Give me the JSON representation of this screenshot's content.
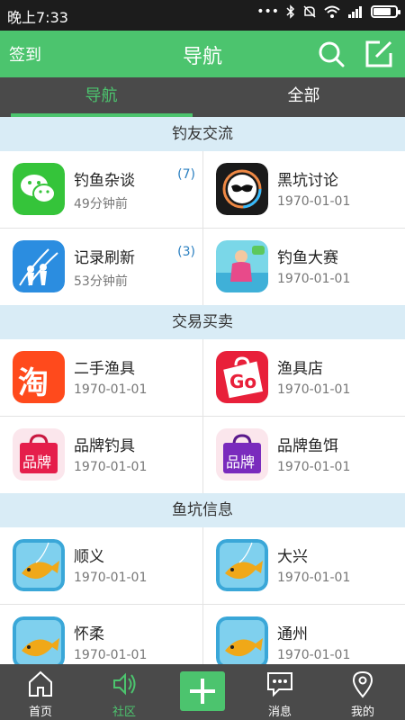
{
  "status_bar": {
    "time": "晚上7:33",
    "icons": [
      "dots-icon",
      "bluetooth-icon",
      "mute-icon",
      "wifi-icon",
      "signal-icon",
      "battery-icon"
    ],
    "battery_level": 0.85
  },
  "header": {
    "signin": "签到",
    "title": "导航",
    "search_icon": "search-icon",
    "edit_icon": "edit-icon",
    "color": "#4cc46e"
  },
  "tabs": [
    {
      "label": "导航",
      "active": true
    },
    {
      "label": "全部",
      "active": false
    }
  ],
  "sections": [
    {
      "title": "钓友交流",
      "items": [
        {
          "name": "钓鱼杂谈",
          "sub": "49分钟前",
          "count": "(7)",
          "icon": "wechat-icon"
        },
        {
          "name": "黑坑讨论",
          "sub": "1970-01-01",
          "count": "",
          "icon": "mask-icon"
        },
        {
          "name": "记录刷新",
          "sub": "53分钟前",
          "count": "(3)",
          "icon": "anglers-icon"
        },
        {
          "name": "钓鱼大赛",
          "sub": "1970-01-01",
          "count": "",
          "icon": "game-icon"
        }
      ]
    },
    {
      "title": "交易买卖",
      "items": [
        {
          "name": "二手渔具",
          "sub": "1970-01-01",
          "count": "",
          "icon": "taobao-icon",
          "badge": "淘"
        },
        {
          "name": "渔具店",
          "sub": "1970-01-01",
          "count": "",
          "icon": "shopping-bag-icon",
          "badge": "Go"
        },
        {
          "name": "品牌钓具",
          "sub": "1970-01-01",
          "count": "",
          "icon": "brand-bag-icon",
          "badge": "品牌"
        },
        {
          "name": "品牌鱼饵",
          "sub": "1970-01-01",
          "count": "",
          "icon": "brand-bag-purple-icon",
          "badge": "品牌"
        }
      ]
    },
    {
      "title": "鱼坑信息",
      "items": [
        {
          "name": "顺义",
          "sub": "1970-01-01",
          "count": "",
          "icon": "fish-icon"
        },
        {
          "name": "大兴",
          "sub": "1970-01-01",
          "count": "",
          "icon": "fish-icon"
        },
        {
          "name": "怀柔",
          "sub": "1970-01-01",
          "count": "",
          "icon": "fish-icon"
        },
        {
          "name": "通州",
          "sub": "1970-01-01",
          "count": "",
          "icon": "fish-icon"
        }
      ]
    }
  ],
  "bottom_nav": [
    {
      "label": "首页",
      "icon": "home-icon",
      "active": false
    },
    {
      "label": "社区",
      "icon": "community-icon",
      "active": true
    },
    {
      "label": "",
      "icon": "plus-icon",
      "active": false
    },
    {
      "label": "消息",
      "icon": "message-icon",
      "active": false
    },
    {
      "label": "我的",
      "icon": "location-pin-icon",
      "active": false
    }
  ]
}
